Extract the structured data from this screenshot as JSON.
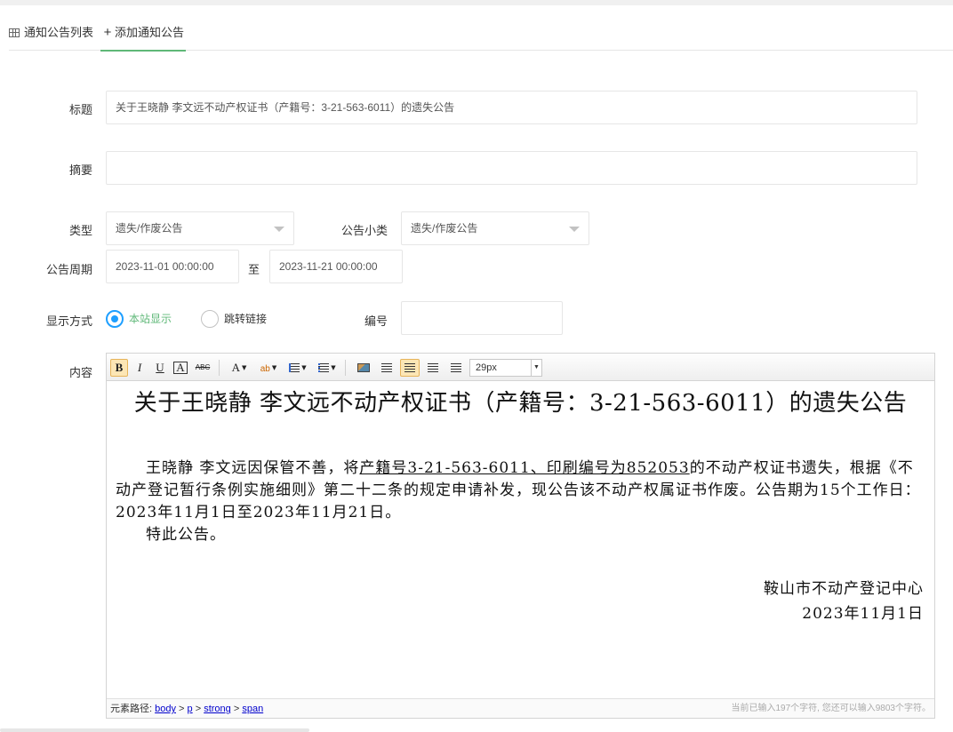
{
  "tabs": {
    "list_label": "通知公告列表",
    "add_label": "添加通知公告"
  },
  "form": {
    "title_label": "标题",
    "title_value": "关于王晓静 李文远不动产权证书（产籍号：3-21-563-6011）的遗失公告",
    "summary_label": "摘要",
    "summary_value": "",
    "type_label": "类型",
    "type_value": "遗失/作废公告",
    "subtype_label": "公告小类",
    "subtype_value": "遗失/作废公告",
    "period_label": "公告周期",
    "period_start": "2023-11-01 00:00:00",
    "period_to": "至",
    "period_end": "2023-11-21 00:00:00",
    "display_label": "显示方式",
    "display_options": [
      "本站显示",
      "跳转链接"
    ],
    "display_selected": "本站显示",
    "number_label": "编号",
    "number_value": "",
    "content_label": "内容"
  },
  "editor": {
    "toolbar": {
      "bold": "B",
      "italic": "I",
      "underline": "U",
      "boxed": "A",
      "strike": "ABC",
      "font_color": "A",
      "highlight": "ab",
      "font_size": "29px"
    },
    "content": {
      "title": "关于王晓静 李文远不动产权证书（产籍号：3-21-563-6011）的遗失公告",
      "para1_a": "王晓静 李文远因保管不善，将",
      "para1_u": "产籍号3-21-563-6011、印刷编号为852053",
      "para1_b": "的不动产权证书遗失，根据《不动产登记暂行条例实施细则》第二十二条的规定申请补发，现公告该不动产权属证书作废。公告期为15个工作日： 2023年11月1日至2023年11月21日。",
      "para2": "特此公告。",
      "sign_org": "鞍山市不动产登记中心",
      "sign_date": "2023年11月1日"
    },
    "status": {
      "path_label": "元素路径:",
      "path": [
        "body",
        "p",
        "strong",
        "span"
      ],
      "count_text": "当前已输入197个字符, 您还可以输入9803个字符。"
    }
  }
}
